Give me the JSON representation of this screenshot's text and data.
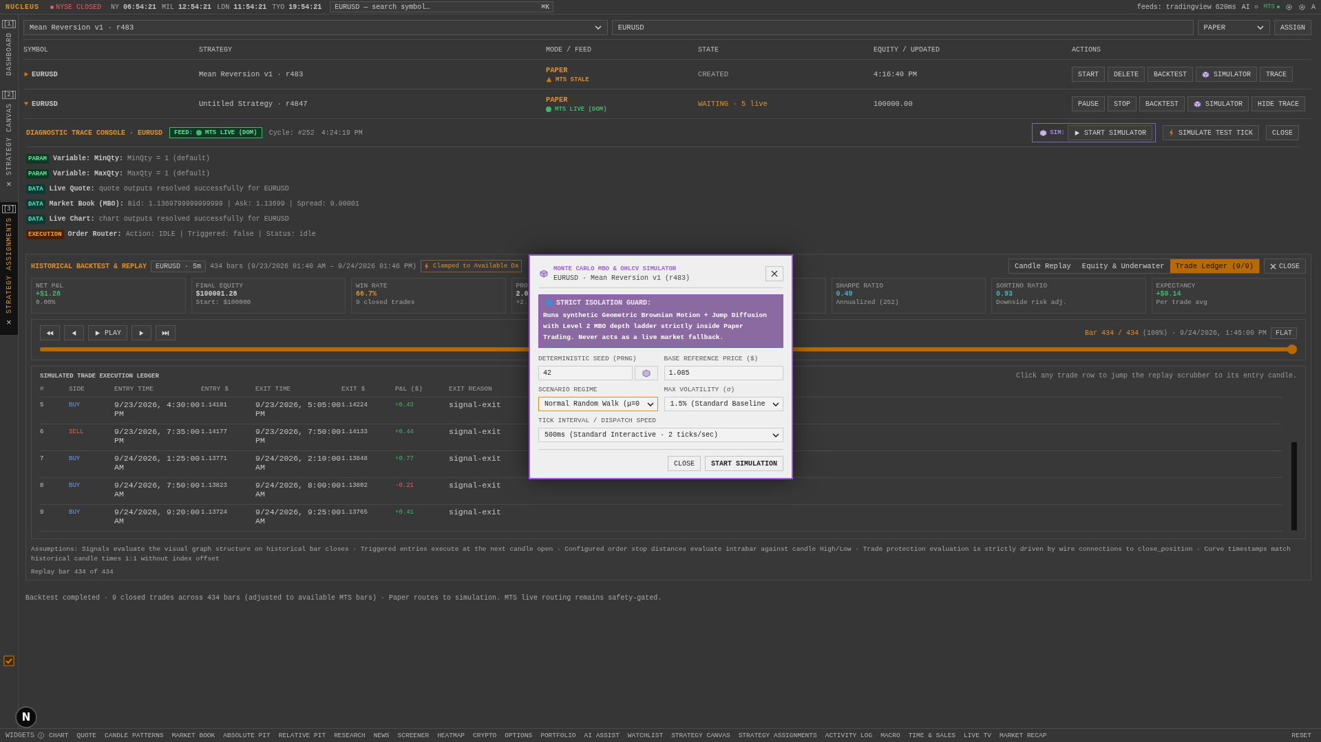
{
  "topbar": {
    "brand": "NUCLEUS",
    "market_status": "NYSE CLOSED",
    "clocks": [
      {
        "city": "NY",
        "time": "06:54:21"
      },
      {
        "city": "MIL",
        "time": "12:54:21"
      },
      {
        "city": "LDN",
        "time": "11:54:21"
      },
      {
        "city": "TYO",
        "time": "19:54:21"
      }
    ],
    "search": {
      "placeholder": "EURUSD — search symbol…",
      "shortcut": "⌘K"
    },
    "feeds": "feeds: tradingview 620ms",
    "ai": "AI ○",
    "mts": "MTS",
    "user": "A"
  },
  "sidebar": {
    "tabs": [
      {
        "index": "[1]",
        "label": "DASHBOARD",
        "selected": false
      },
      {
        "index": "[2]",
        "label": "STRATEGY CANVAS",
        "close": "×",
        "selected": false
      },
      {
        "index": "[3]",
        "label": "STRATEGY ASSIGNMENTS",
        "close": "×",
        "selected": true
      }
    ]
  },
  "assign": {
    "strategy": "Mean Reversion v1 · r483",
    "symbol": "EURUSD",
    "mode": "PAPER",
    "button": "ASSIGN"
  },
  "table": {
    "columns": [
      "SYMBOL",
      "STRATEGY",
      "MODE / FEED",
      "STATE",
      "EQUITY / UPDATED",
      "ACTIONS"
    ],
    "rows": [
      {
        "expanded": false,
        "symbol": "EURUSD",
        "strategy": "Mean Reversion v1 · r483",
        "mode": "PAPER",
        "feed": {
          "kind": "stale",
          "text": "MTS STALE"
        },
        "state": {
          "text": "CREATED",
          "kind": "idle"
        },
        "equity": "4:16:40 PM",
        "actions": [
          {
            "label": "START",
            "kind": "plain"
          },
          {
            "label": "DELETE",
            "kind": "plain"
          },
          {
            "label": "BACKTEST",
            "kind": "plain"
          },
          {
            "label": "SIMULATOR",
            "kind": "simulator"
          },
          {
            "label": "TRACE",
            "kind": "plain"
          }
        ]
      },
      {
        "expanded": true,
        "symbol": "EURUSD",
        "strategy": "Untitled Strategy · r4847",
        "mode": "PAPER",
        "feed": {
          "kind": "live",
          "text": "MTS LIVE (DOM)"
        },
        "state": {
          "text": "WAITING · 5 live",
          "kind": "waiting"
        },
        "equity": "100000.00",
        "actions": [
          {
            "label": "PAUSE",
            "kind": "plain"
          },
          {
            "label": "STOP",
            "kind": "plain"
          },
          {
            "label": "BACKTEST",
            "kind": "plain"
          },
          {
            "label": "SIMULATOR",
            "kind": "simulator"
          },
          {
            "label": "HIDE TRACE",
            "kind": "plain"
          }
        ]
      }
    ]
  },
  "console": {
    "title": "DIAGNOSTIC TRACE CONSOLE · EURUSD",
    "feed_label": "FEED:",
    "feed": "MTS LIVE (DOM)",
    "cycle": "Cycle: #252",
    "time": "4:24:19 PM",
    "sim_label": "SIM:",
    "start": "START SIMULATOR",
    "test_tick": "SIMULATE TEST TICK",
    "close": "CLOSE",
    "logs": [
      {
        "kind": "param",
        "tag": "PARAM",
        "label": "Variable: MinQty:",
        "text": "MinQty = 1 (default)"
      },
      {
        "kind": "param",
        "tag": "PARAM",
        "label": "Variable: MaxQty:",
        "text": "MaxQty = 1 (default)"
      },
      {
        "kind": "data",
        "tag": "DATA",
        "label": "Live Quote:",
        "text": "quote outputs resolved successfully for EURUSD"
      },
      {
        "kind": "data",
        "tag": "DATA",
        "label": "Market Book (MBO):",
        "text": "Bid: 1.1369799999999999 | Ask: 1.13699 | Spread: 0.00001"
      },
      {
        "kind": "data",
        "tag": "DATA",
        "label": "Live Chart:",
        "text": "chart outputs resolved successfully for EURUSD"
      },
      {
        "kind": "execution",
        "tag": "EXECUTION",
        "label": "Order Router:",
        "text": "Action: IDLE | Triggered: false | Status: idle"
      }
    ]
  },
  "backtest": {
    "title": "HISTORICAL BACKTEST & REPLAY",
    "symbol_chip": "EURUSD · 5m",
    "range": "434 bars (9/23/2026 01:40 AM – 9/24/2026 01:46 PM)",
    "clamp": "Clamped to Available Da",
    "views": [
      {
        "label": "Candle Replay",
        "selected": false
      },
      {
        "label": "Equity & Underwater",
        "selected": false
      },
      {
        "label": "Trade Ledger (9/9)",
        "selected": true
      }
    ],
    "close": "CLOSE",
    "metrics": [
      {
        "label": "NET P&L",
        "value": "+$1.28",
        "kind": "positive",
        "sub": "0.00%"
      },
      {
        "label": "FINAL EQUITY",
        "value": "$100001.28",
        "kind": "neutral",
        "sub": "Start: $100000"
      },
      {
        "label": "WIN RATE",
        "value": "66.7%",
        "kind": "warning",
        "sub": "9 closed trades"
      },
      {
        "label": "PRO",
        "value": "2.0",
        "kind": "neutral",
        "sub": "+2."
      },
      {
        "label": "SHARPE RATIO",
        "value": "0.49",
        "kind": "info",
        "sub": "Annualized (252)"
      },
      {
        "label": "SORTINO RATIO",
        "value": "0.93",
        "kind": "info",
        "sub": "Downside risk adj."
      },
      {
        "label": "EXPECTANCY",
        "value": "+$0.14",
        "kind": "positive",
        "sub": "Per trade avg"
      }
    ],
    "replay": {
      "play": "PLAY",
      "position": "Bar 434 / 434",
      "detail": "(100%) · 9/24/2026, 1:45:00 PM",
      "flat": "FLAT",
      "level": 1
    },
    "ledger": {
      "title": "SIMULATED TRADE EXECUTION LEDGER",
      "hint": "Click any trade row to jump the replay scrubber to its entry candle.",
      "columns": [
        "#",
        "SIDE",
        "ENTRY TIME",
        "ENTRY $",
        "EXIT TIME",
        "EXIT $",
        "P&L ($)",
        "EXIT REASON"
      ],
      "rows": [
        {
          "n": "5",
          "side": "BUY",
          "kind": "buy",
          "entry_time": "9/23/2026, 4:30:00 PM",
          "entry": "1.14181",
          "exit_time": "9/23/2026, 5:05:00 PM",
          "exit": "1.14224",
          "pnl": "+0.43",
          "loss": false,
          "reason": "signal-exit"
        },
        {
          "n": "6",
          "side": "SELL",
          "kind": "sell",
          "entry_time": "9/23/2026, 7:35:00 PM",
          "entry": "1.14177",
          "exit_time": "9/23/2026, 7:50:00 PM",
          "exit": "1.14133",
          "pnl": "+0.44",
          "loss": false,
          "reason": "signal-exit"
        },
        {
          "n": "7",
          "side": "BUY",
          "kind": "buy",
          "entry_time": "9/24/2026, 1:25:00 AM",
          "entry": "1.13771",
          "exit_time": "9/24/2026, 2:10:00 AM",
          "exit": "1.13848",
          "pnl": "+0.77",
          "loss": false,
          "reason": "signal-exit"
        },
        {
          "n": "8",
          "side": "BUY",
          "kind": "buy",
          "entry_time": "9/24/2026, 7:50:00 AM",
          "entry": "1.13823",
          "exit_time": "9/24/2026, 8:00:00 AM",
          "exit": "1.13802",
          "pnl": "-0.21",
          "loss": true,
          "reason": "signal-exit"
        },
        {
          "n": "9",
          "side": "BUY",
          "kind": "buy",
          "entry_time": "9/24/2026, 9:20:00 AM",
          "entry": "1.13724",
          "exit_time": "9/24/2026, 9:25:00 AM",
          "exit": "1.13765",
          "pnl": "+0.41",
          "loss": false,
          "reason": "signal-exit"
        }
      ]
    },
    "assumptions": "Assumptions: Signals evaluate the visual graph structure on historical bar closes · Triggered entries execute at the next candle open · Configured order stop distances evaluate intrabar against candle High/Low · Trade protection evaluation is strictly driven by wire connections to close_position · Curve timestamps match historical candle times 1:1 without index offset",
    "replay_note": "Replay bar 434 of 434"
  },
  "status": "Backtest completed · 9 closed trades across 434 bars (adjusted to available MTS bars) · Paper routes to simulation. MTS live routing remains safety-gated.",
  "fab": "N",
  "bottom_bar": {
    "label": "WIDGETS",
    "items": [
      "CHART",
      "QUOTE",
      "CANDLE PATTERNS",
      "MARKET BOOK",
      "ABSOLUTE PIT",
      "RELATIVE PIT",
      "RESEARCH",
      "NEWS",
      "SCREENER",
      "HEATMAP",
      "CRYPTO",
      "OPTIONS",
      "PORTFOLIO",
      "AI ASSIST",
      "WATCHLIST",
      "STRATEGY CANVAS",
      "STRATEGY ASSIGNMENTS",
      "ACTIVITY LOG",
      "MACRO",
      "TIME & SALES",
      "LIVE TV",
      "MARKET RECAP"
    ],
    "reset": "RESET"
  },
  "modal": {
    "title": "MONTE CARLO MBO & OHLCV SIMULATOR",
    "subtitle": "EURUSD · Mean Reversion v1 (r483)",
    "guard_title": "STRICT ISOLATION GUARD:",
    "guard_text": "Runs synthetic Geometric Brownian Motion + Jump Diffusion with Level 2 MBO depth ladder strictly inside Paper Trading. Never acts as a live market fallback.",
    "seed": {
      "label": "DETERMINISTIC SEED (PRNG)",
      "value": "42"
    },
    "price": {
      "label": "BASE REFERENCE PRICE ($)",
      "value": "1.085"
    },
    "scenario": {
      "label": "SCENARIO REGIME",
      "value": "Normal Random Walk (μ=0",
      "focused": true
    },
    "volatility": {
      "label": "MAX VOLATILITY (σ)",
      "value": "1.5% (Standard Baseline",
      "focused": false
    },
    "tick": {
      "label": "TICK INTERVAL / DISPATCH SPEED",
      "value": "500ms (Standard Interactive · 2 ticks/sec)",
      "focused": false
    },
    "close": "CLOSE",
    "start": "START SIMULATION"
  }
}
